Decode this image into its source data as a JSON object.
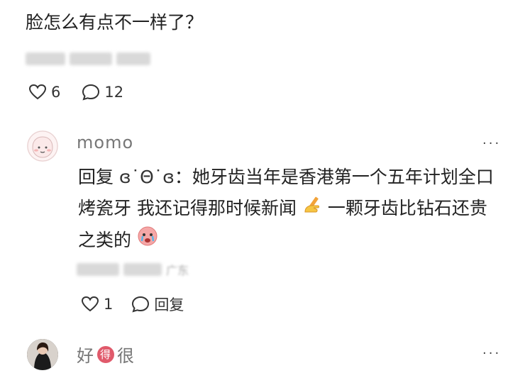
{
  "post": {
    "text": "脸怎么有点不一样了？",
    "actions": {
      "likes": "6",
      "comments": "12"
    }
  },
  "reply1": {
    "username": "momo",
    "more_label": "···",
    "reply_prefix": "回复",
    "reply_to": "ɞ˙Θ˙ɞ",
    "colon": "：",
    "text_part1": "她牙齿当年是香港第一个五年计划全口烤瓷牙 我还记得那时候新闻",
    "text_part2": "一颗牙齿比钻石还贵之类的",
    "meta_blurred_suffix": "广东",
    "actions": {
      "likes": "1",
      "reply_label": "回复"
    }
  },
  "reply2": {
    "username_part1": "好",
    "badge_char": "得",
    "username_part2": "很",
    "more_label": "···"
  },
  "colors": {
    "badge": "#e05a6b",
    "avatar_bg": "#f6e6e6",
    "blur": "#d9d9d9"
  },
  "icons": [
    "heart-icon",
    "comment-bubble-icon",
    "more-icon",
    "writing-hand-emoji",
    "crying-face-emoji"
  ]
}
